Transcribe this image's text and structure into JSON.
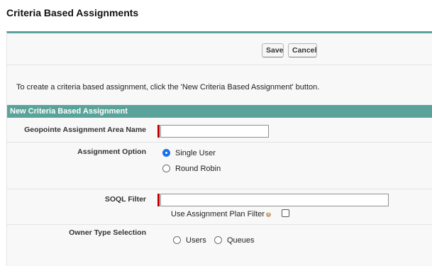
{
  "page": {
    "title": "Criteria Based Assignments"
  },
  "toolbar": {
    "save_label": "Save",
    "cancel_label": "Cancel"
  },
  "info": {
    "text": "To create a criteria based assignment, click the 'New Criteria Based Assignment' button."
  },
  "section": {
    "title": "New Criteria Based Assignment"
  },
  "form": {
    "area_name": {
      "label": "Geopointe Assignment Area Name",
      "value": "",
      "required": true
    },
    "assignment_option": {
      "label": "Assignment Option",
      "options": [
        {
          "label": "Single User",
          "selected": true
        },
        {
          "label": "Round Robin",
          "selected": false
        }
      ]
    },
    "soql_filter": {
      "label": "SOQL Filter",
      "value": "",
      "required": true
    },
    "use_assignment_plan_filter": {
      "label": "Use Assignment Plan Filter",
      "checked": false,
      "help_icon": "help-icon"
    },
    "owner_type": {
      "label": "Owner Type Selection",
      "options": [
        {
          "label": "Users",
          "selected": false
        },
        {
          "label": "Queues",
          "selected": false
        }
      ]
    }
  },
  "colors": {
    "accent": "#5aa39a",
    "required": "#c00000",
    "radio_selected": "#1a73e8"
  }
}
